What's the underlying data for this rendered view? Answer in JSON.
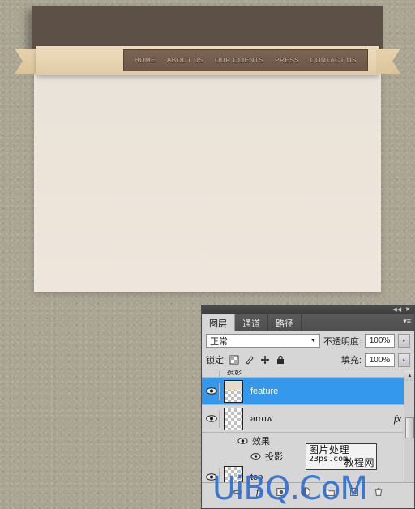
{
  "site": {
    "nav_items": [
      {
        "label": "HOME"
      },
      {
        "label": "ABOUT US"
      },
      {
        "label": "OUR CLIENTS"
      },
      {
        "label": "PRESS"
      },
      {
        "label": "CONTACT US"
      }
    ]
  },
  "panel": {
    "titlebar": {
      "collapse_icon": "◀◀",
      "close_icon": "✖"
    },
    "tabs": [
      {
        "label": "图层",
        "active": true
      },
      {
        "label": "通道",
        "active": false
      },
      {
        "label": "路径",
        "active": false
      }
    ],
    "menu_icon": "▾≡",
    "blend": {
      "mode_value": "正常",
      "caret": "▼",
      "opacity_label": "不透明度:",
      "opacity_value": "100%",
      "spin": "▸"
    },
    "lock": {
      "label": "锁定:",
      "icons": [
        {
          "name": "lock-transparent-pixels-icon"
        },
        {
          "name": "lock-image-pixels-icon"
        },
        {
          "name": "lock-position-icon"
        },
        {
          "name": "lock-all-icon"
        }
      ],
      "fill_label": "填充:",
      "fill_value": "100%",
      "spin": "▸"
    },
    "layers": [
      {
        "name": "投影",
        "clipped": true
      },
      {
        "name": "feature",
        "selected": true,
        "has_fx": false
      },
      {
        "name": "arrow",
        "selected": false,
        "has_fx": true,
        "fx_mark": "fx"
      },
      {
        "name": "top",
        "selected": false,
        "has_fx": false,
        "clipped_bottom": true
      }
    ],
    "effects": [
      {
        "label": "效果",
        "level": 0
      },
      {
        "label": "投影",
        "level": 1
      }
    ],
    "scrollbar": {
      "up_arrow": "▲",
      "down_arrow": "▼"
    },
    "bottom_buttons": [
      {
        "name": "link-layers-icon"
      },
      {
        "name": "layer-style-fx-icon",
        "glyph": "fx"
      },
      {
        "name": "add-layer-mask-icon"
      },
      {
        "name": "new-fill-adjustment-layer-icon"
      },
      {
        "name": "new-group-icon"
      },
      {
        "name": "new-layer-icon"
      },
      {
        "name": "delete-layer-icon"
      }
    ]
  },
  "watermarks": {
    "box_line1": "图片处理",
    "box_line2": "23ps.com",
    "box_overlay": "教程网",
    "big_text": "UiBQ.CoM"
  },
  "colors": {
    "page_bg": "#aaa593",
    "header_bar": "#5d5046",
    "content_panel": "#ebe5dc",
    "ribbon": "#e7d3b0",
    "nav_bar": "#6d5646",
    "nav_text": "#c3b2a2",
    "selection_blue": "#3498ec",
    "panel_bg": "#d6d6d6",
    "watermark_blue": "#2f6fd0"
  }
}
